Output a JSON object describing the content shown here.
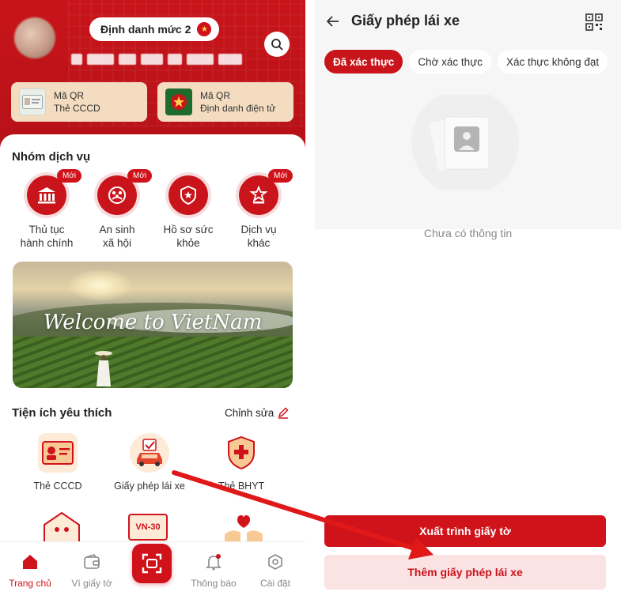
{
  "colors": {
    "primary": "#d0131b",
    "primary_light": "#fbe2e3",
    "card_bg": "#f3dcc0"
  },
  "home": {
    "identity_level": "Định danh mức 2",
    "qr_cards": [
      {
        "line1": "Mã QR",
        "line2": "Thẻ CCCD"
      },
      {
        "line1": "Mã QR",
        "line2": "Định danh điện tử"
      }
    ],
    "services_title": "Nhóm dịch vụ",
    "services": [
      {
        "label_1": "Thủ tục",
        "label_2": "hành chính",
        "icon": "bank-icon",
        "new": "Mới"
      },
      {
        "label_1": "An sinh",
        "label_2": "xã hội",
        "icon": "family-icon",
        "new": "Mới"
      },
      {
        "label_1": "Hồ sơ sức",
        "label_2": "khỏe",
        "icon": "health-shield-icon",
        "new": ""
      },
      {
        "label_1": "Dịch vụ",
        "label_2": "khác",
        "icon": "star-podium-icon",
        "new": "Mới"
      }
    ],
    "banner_text": "Welcome to VietNam",
    "favorites_title": "Tiện ích yêu thích",
    "favorites_edit": "Chỉnh sửa",
    "favorites": [
      {
        "label": "Thẻ CCCD",
        "icon": "id-card-icon"
      },
      {
        "label": "Giấy phép lái xe",
        "icon": "driver-license-icon"
      },
      {
        "label": "Thẻ BHYT",
        "icon": "health-insurance-icon"
      }
    ],
    "favorites_row2_badge": "VN-30",
    "nav": [
      {
        "label": "Trang chủ",
        "icon": "home-icon"
      },
      {
        "label": "Ví giấy tờ",
        "icon": "wallet-icon"
      },
      {
        "label": "Thông báo",
        "icon": "bell-icon"
      },
      {
        "label": "Cài đặt",
        "icon": "settings-icon"
      }
    ]
  },
  "license": {
    "title": "Giấy phép lái xe",
    "tabs": [
      "Đã xác thực",
      "Chờ xác thực",
      "Xác thực không đạt"
    ],
    "active_tab": "Đã xác thực",
    "empty_text": "Chưa có thông tin",
    "present_button": "Xuất trình giấy tờ",
    "add_button": "Thêm giấy phép lái xe"
  }
}
